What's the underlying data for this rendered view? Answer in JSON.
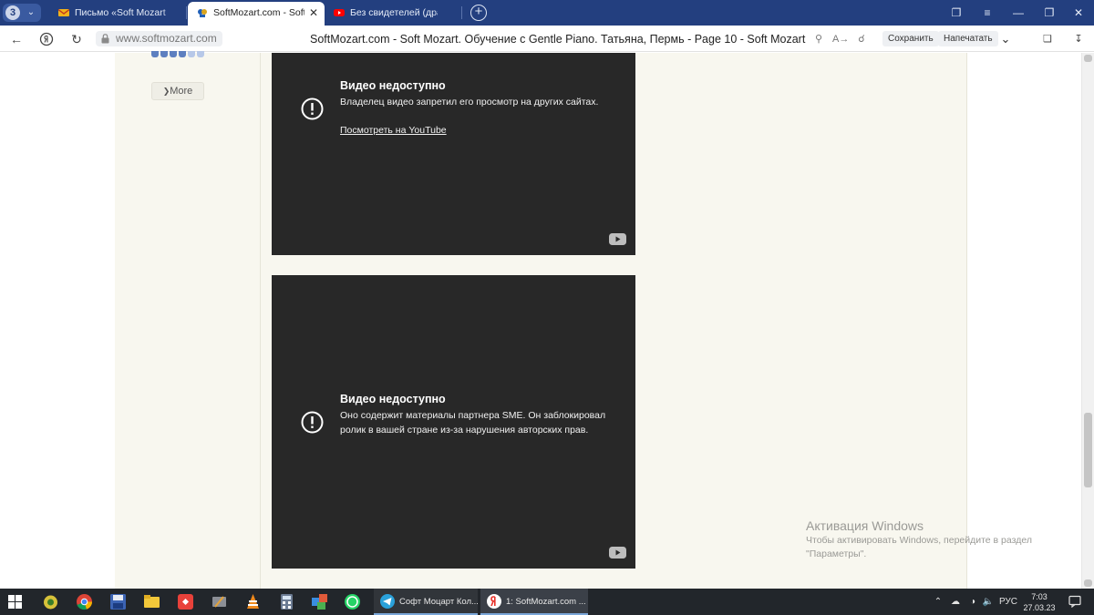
{
  "browser": {
    "tab_count": "3",
    "tabs": [
      {
        "title": "Письмо «Soft Mozart. Обу",
        "active": false
      },
      {
        "title": "SoftMozart.com - Soft M",
        "active": true
      },
      {
        "title": "Без свидетелей (драма, р",
        "active": false
      }
    ],
    "url": "www.softmozart.com",
    "page_title": "SoftMozart.com - Soft Mozart. Обучение с Gentle Piano. Татьяна, Пермь - Page 10 - Soft Mozart",
    "save_label": "Сохранить",
    "print_label": "Напечатать"
  },
  "sidebar": {
    "more_label": "More"
  },
  "videos": [
    {
      "title": "Видео недоступно",
      "message": "Владелец видео запретил его просмотр на других сайтах.",
      "link": "Посмотреть на YouTube"
    },
    {
      "title": "Видео недоступно",
      "message": "Оно содержит материалы партнера SME. Он заблокировал ролик в вашей стране из-за нарушения авторских прав.",
      "link": ""
    }
  ],
  "activation": {
    "title": "Активация Windows",
    "subtitle": "Чтобы активировать Windows, перейдите в раздел \"Параметры\"."
  },
  "taskbar": {
    "tasks": [
      {
        "label": "Софт Моцарт Кол..."
      },
      {
        "label": "1: SoftMozart.com ..."
      }
    ],
    "language": "РУС",
    "time": "7:03",
    "date": "27.03.23"
  },
  "colors": {
    "tab_strip": "#233f7f",
    "page_background": "#f8f7ef",
    "video_background": "#282828",
    "taskbar": "#22262b"
  }
}
